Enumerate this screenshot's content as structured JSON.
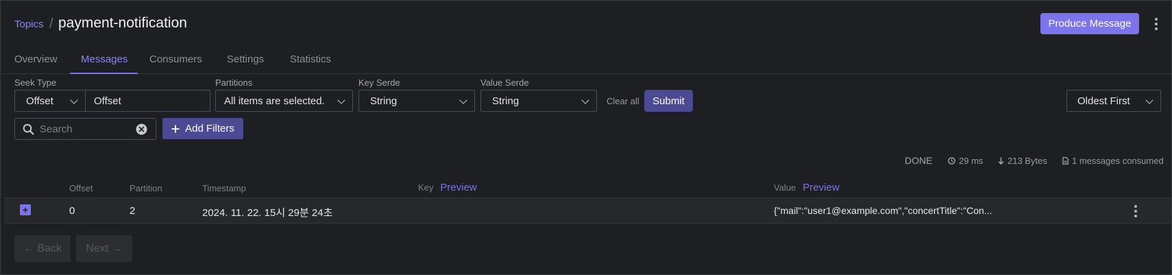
{
  "breadcrumb": {
    "parent": "Topics",
    "separator": "/",
    "title": "payment-notification"
  },
  "header": {
    "produce_label": "Produce Message"
  },
  "tabs": [
    {
      "label": "Overview"
    },
    {
      "label": "Messages",
      "active": true
    },
    {
      "label": "Consumers"
    },
    {
      "label": "Settings"
    },
    {
      "label": "Statistics"
    }
  ],
  "filters": {
    "seek_type": {
      "label": "Seek Type",
      "value": "Offset",
      "input_value": "Offset"
    },
    "partitions": {
      "label": "Partitions",
      "value": "All items are selected."
    },
    "key_serde": {
      "label": "Key Serde",
      "value": "String"
    },
    "value_serde": {
      "label": "Value Serde",
      "value": "String"
    },
    "clear_all": "Clear all",
    "submit": "Submit",
    "sort": "Oldest First",
    "search_placeholder": "Search",
    "add_filters": "Add Filters"
  },
  "stats": {
    "status": "DONE",
    "time": "29 ms",
    "bytes": "213 Bytes",
    "consumed": "1 messages consumed"
  },
  "table": {
    "headers": {
      "offset": "Offset",
      "partition": "Partition",
      "timestamp": "Timestamp",
      "key": "Key",
      "value": "Value",
      "preview": "Preview"
    },
    "rows": [
      {
        "offset": "0",
        "partition": "2",
        "timestamp": "2024. 11. 22. 15시 29분 24초",
        "key": "",
        "value": "{\"mail\":\"user1@example.com\",\"concertTitle\":\"Con..."
      }
    ]
  },
  "pagination": {
    "back": "← Back",
    "next": "Next →"
  },
  "colors": {
    "accent": "#7b74ea",
    "background": "#1d1f23",
    "button_dark": "#4d4a94"
  }
}
